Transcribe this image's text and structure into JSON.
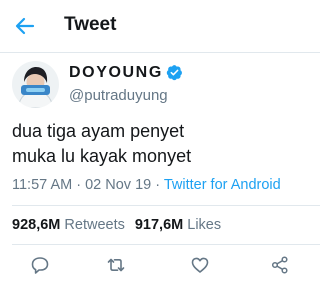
{
  "header": {
    "title": "Tweet"
  },
  "author": {
    "name": "DOYOUNG",
    "handle": "@putraduyung",
    "verified": true
  },
  "tweet": {
    "lines": [
      "dua tiga ayam penyet",
      "muka lu kayak monyet"
    ]
  },
  "meta": {
    "time": "11:57 AM",
    "sep1": " · ",
    "date": "02 Nov 19",
    "sep2": " · ",
    "source": "Twitter for Android"
  },
  "stats": {
    "retweets_count": "928,6M",
    "retweets_label": "Retweets",
    "likes_count": "917,6M",
    "likes_label": "Likes"
  },
  "actions": {
    "icons": [
      "reply-icon",
      "retweet-icon",
      "like-icon",
      "share-icon"
    ]
  },
  "colors": {
    "accent": "#1da1f2",
    "text": "#14171a",
    "secondary": "#657786",
    "divider": "#e1e8ed"
  }
}
